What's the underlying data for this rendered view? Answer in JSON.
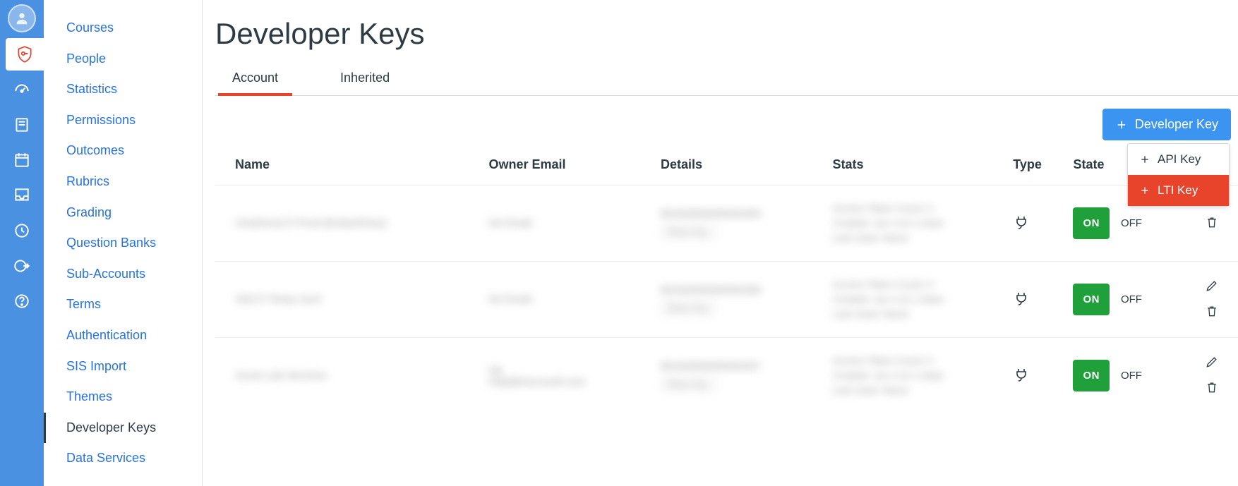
{
  "rail": {
    "items": [
      "avatar",
      "keys",
      "speedometer",
      "book",
      "calendar",
      "inbox",
      "history",
      "logout",
      "help"
    ]
  },
  "sidenav": {
    "items": [
      {
        "label": "Courses"
      },
      {
        "label": "People"
      },
      {
        "label": "Statistics"
      },
      {
        "label": "Permissions"
      },
      {
        "label": "Outcomes"
      },
      {
        "label": "Rubrics"
      },
      {
        "label": "Grading"
      },
      {
        "label": "Question Banks"
      },
      {
        "label": "Sub-Accounts"
      },
      {
        "label": "Terms"
      },
      {
        "label": "Authentication"
      },
      {
        "label": "SIS Import"
      },
      {
        "label": "Themes"
      },
      {
        "label": "Developer Keys",
        "current": true
      },
      {
        "label": "Data Services"
      }
    ]
  },
  "page": {
    "title": "Developer Keys"
  },
  "tabs": [
    {
      "label": "Account",
      "active": true
    },
    {
      "label": "Inherited"
    }
  ],
  "toolbar": {
    "developer_key_label": "Developer Key"
  },
  "dropdown": {
    "api": "API Key",
    "lti": "LTI Key"
  },
  "table": {
    "headers": {
      "name": "Name",
      "email": "Owner Email",
      "details": "Details",
      "stats": "Stats",
      "type": "Type",
      "state": "State"
    },
    "state_on": "ON",
    "state_off": "OFF",
    "rows": [
      {
        "name": "OneDriveLTI-Prod (EmbedView)",
        "email": "No Email",
        "details_id": "85340000000000309",
        "details_btn": "Show Key",
        "stats": "Access Token Count: 0\nCreated: Jun 4 at 1:14am\nLast Used: Never",
        "show_edit": false
      },
      {
        "name": "ODLTI-Temp-Jun4",
        "email": "No Email",
        "details_id": "85340000000000308",
        "details_btn": "Show Key",
        "stats": "Access Token Count: 0\nCreated: Jun 4 at 1:24am\nLast Used: Never",
        "show_edit": true
      },
      {
        "name": "Azure Lab Services",
        "email": "sip\nhelp@microsoft.com",
        "details_id": "85340000000000307",
        "details_btn": "Show Key",
        "stats": "Access Token Count: 0\nCreated: Jun 2 at 1:14pm\nLast Used: Never",
        "show_edit": true
      }
    ]
  }
}
